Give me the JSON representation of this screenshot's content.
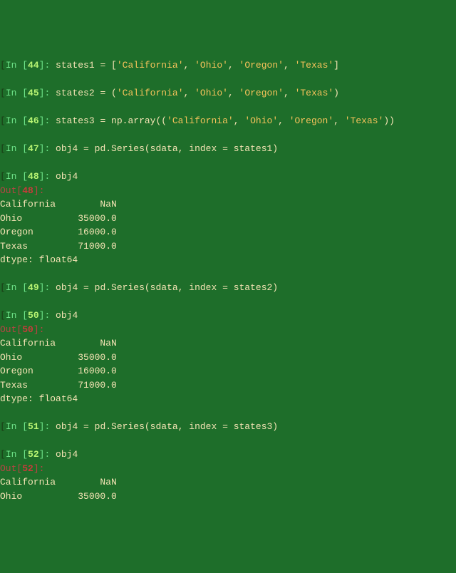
{
  "cells": [
    {
      "in_num": "44",
      "code_segments": [
        {
          "t": "states1 = [",
          "c": "code"
        },
        {
          "t": "'California'",
          "c": "str"
        },
        {
          "t": ", ",
          "c": "code"
        },
        {
          "t": "'Ohio'",
          "c": "str"
        },
        {
          "t": ", ",
          "c": "code"
        },
        {
          "t": "'Oregon'",
          "c": "str"
        },
        {
          "t": ", ",
          "c": "code"
        },
        {
          "t": "'Texas'",
          "c": "str"
        },
        {
          "t": "]",
          "c": "code"
        }
      ]
    },
    {
      "in_num": "45",
      "code_segments": [
        {
          "t": "states2 = (",
          "c": "code"
        },
        {
          "t": "'California'",
          "c": "str"
        },
        {
          "t": ", ",
          "c": "code"
        },
        {
          "t": "'Ohio'",
          "c": "str"
        },
        {
          "t": ", ",
          "c": "code"
        },
        {
          "t": "'Oregon'",
          "c": "str"
        },
        {
          "t": ", ",
          "c": "code"
        },
        {
          "t": "'Texas'",
          "c": "str"
        },
        {
          "t": ")",
          "c": "code"
        }
      ]
    },
    {
      "in_num": "46",
      "code_segments": [
        {
          "t": "states3 = np.array((",
          "c": "code"
        },
        {
          "t": "'California'",
          "c": "str"
        },
        {
          "t": ", ",
          "c": "code"
        },
        {
          "t": "'Ohio'",
          "c": "str"
        },
        {
          "t": ", ",
          "c": "code"
        },
        {
          "t": "'Oregon'",
          "c": "str"
        },
        {
          "t": ", ",
          "c": "code"
        },
        {
          "t": "'Texas'",
          "c": "str"
        },
        {
          "t": "))",
          "c": "code"
        }
      ]
    },
    {
      "in_num": "47",
      "code_segments": [
        {
          "t": "obj4 = pd.Series(sdata, index = states1)",
          "c": "code"
        }
      ]
    },
    {
      "in_num": "48",
      "code_segments": [
        {
          "t": "obj4",
          "c": "code"
        }
      ],
      "out_num": "48",
      "out_lines": [
        "California        NaN",
        "Ohio          35000.0",
        "Oregon        16000.0",
        "Texas         71000.0",
        "dtype: float64"
      ]
    },
    {
      "in_num": "49",
      "code_segments": [
        {
          "t": "obj4 = pd.Series(sdata, index = states2)",
          "c": "code"
        }
      ]
    },
    {
      "in_num": "50",
      "code_segments": [
        {
          "t": "obj4",
          "c": "code"
        }
      ],
      "out_num": "50",
      "out_lines": [
        "California        NaN",
        "Ohio          35000.0",
        "Oregon        16000.0",
        "Texas         71000.0",
        "dtype: float64"
      ]
    },
    {
      "in_num": "51",
      "code_segments": [
        {
          "t": "obj4 = pd.Series(sdata, index = states3)",
          "c": "code"
        }
      ]
    },
    {
      "in_num": "52",
      "code_segments": [
        {
          "t": "obj4",
          "c": "code"
        }
      ],
      "out_num": "52",
      "out_lines": [
        "California        NaN",
        "Ohio          35000.0"
      ]
    }
  ],
  "prompts": {
    "in_prefix": "In [",
    "in_suffix": "]: ",
    "out_prefix": "Out[",
    "out_suffix": "]:"
  }
}
